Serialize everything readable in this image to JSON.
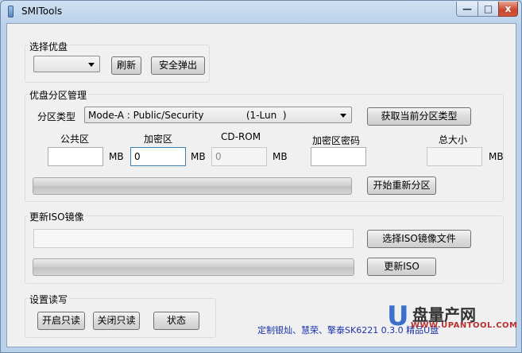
{
  "window": {
    "title": "SMITools",
    "minimize": "—",
    "maximize": "□",
    "close": "x"
  },
  "select_disk": {
    "group_title": "选择优盘",
    "combo_value": "",
    "refresh_label": "刷新",
    "eject_label": "安全弹出"
  },
  "partition": {
    "group_title": "优盘分区管理",
    "type_label": "分区类型",
    "type_value": "Mode-A : Public/Security              (1-Lun  )",
    "get_type_label": "获取当前分区类型",
    "public_label": "公共区",
    "public_value": "",
    "public_unit": "MB",
    "encrypted_label": "加密区",
    "encrypted_value": "0",
    "encrypted_unit": "MB",
    "cdrom_label": "CD-ROM",
    "cdrom_value": "0",
    "cdrom_unit": "MB",
    "password_label": "加密区密码",
    "password_value": "",
    "total_label": "总大小",
    "total_value": "",
    "total_unit": "MB",
    "progress": 0,
    "start_label": "开始重新分区"
  },
  "iso": {
    "group_title": "更新ISO镜像",
    "path_value": "",
    "select_label": "选择ISO镜像文件",
    "progress": 0,
    "update_label": "更新ISO"
  },
  "readonly": {
    "group_title": "设置读写",
    "enable_label": "开启只读",
    "disable_label": "关闭只读",
    "status_label": "状态"
  },
  "footer": {
    "text": "定制银灿、慧荣、擎泰SK6221   0.3.0        精品U盘"
  },
  "watermark": {
    "letter": "U",
    "cn": "盘量产网",
    "url": "WWW.UPANTOOL.COM"
  },
  "colors": {
    "footer_text": "#1a33a8",
    "watermark_blue": "#1d5ac7",
    "watermark_red": "#b83030"
  }
}
